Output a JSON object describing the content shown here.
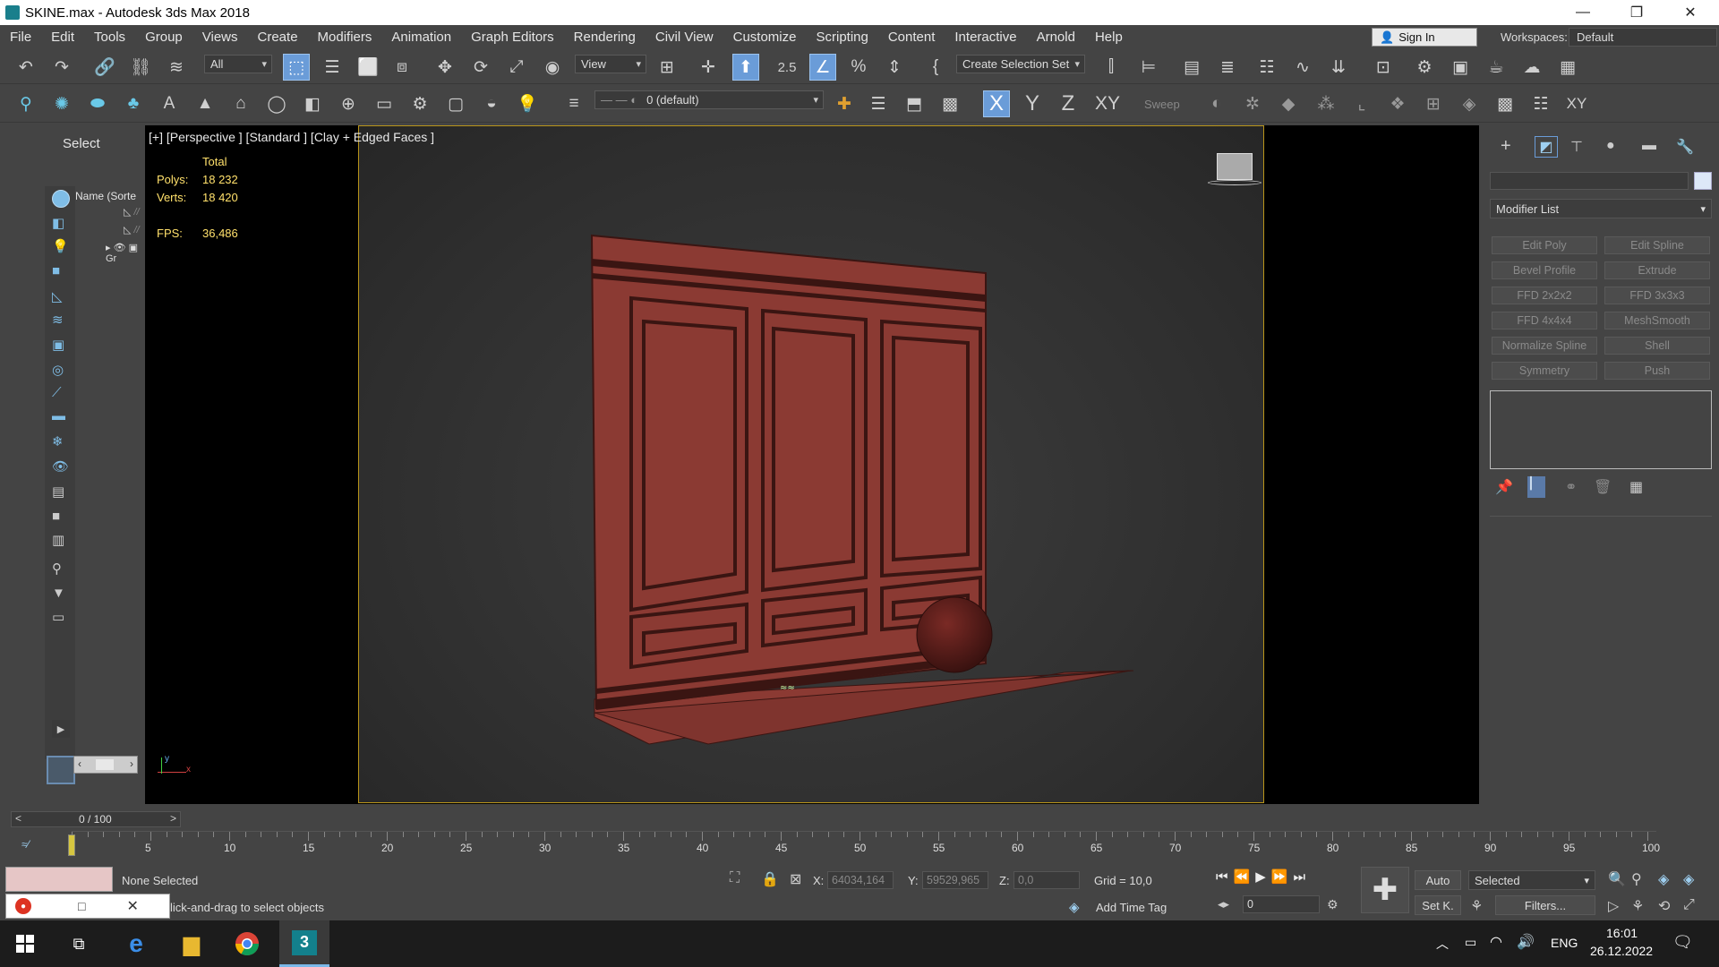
{
  "window": {
    "title": "SKINE.max - Autodesk 3ds Max 2018",
    "minimize": "—",
    "maximize": "❐",
    "close": "✕"
  },
  "menu": {
    "items": [
      "File",
      "Edit",
      "Tools",
      "Group",
      "Views",
      "Create",
      "Modifiers",
      "Animation",
      "Graph Editors",
      "Rendering",
      "Civil View",
      "Customize",
      "Scripting",
      "Content",
      "Interactive",
      "Arnold",
      "Help"
    ],
    "sign_in": "Sign In",
    "workspace_label": "Workspaces:",
    "workspace_value": "Default"
  },
  "toolbar1": {
    "filter_value": "All",
    "ref_coord_value": "View",
    "snap_label": "2.5",
    "selection_set": "Create Selection Set"
  },
  "toolbar2": {
    "layer_value": "0 (default)",
    "axis_x": "X",
    "axis_y": "Y",
    "axis_z": "Z",
    "axis_xy": "XY",
    "sweep_label": "Sweep"
  },
  "explorer": {
    "tab_select": "Select",
    "column_name": "Name (Sorte",
    "rows": [
      "//",
      "//",
      "Gr"
    ]
  },
  "viewport": {
    "label": "[+] [Perspective ] [Standard ] [Clay + Edged Faces ]",
    "stats_header": "Total",
    "polys_label": "Polys:",
    "polys_value": "18 232",
    "verts_label": "Verts:",
    "verts_value": "18 420",
    "fps_label": "FPS:",
    "fps_value": "36,486",
    "axis_y": "y",
    "axis_x": "x"
  },
  "command_panel": {
    "modifier_list": "Modifier List",
    "buttons": [
      "Edit Poly",
      "Edit Spline",
      "Bevel Profile",
      "Extrude",
      "FFD 2x2x2",
      "FFD 3x3x3",
      "FFD 4x4x4",
      "MeshSmooth",
      "Normalize Spline",
      "Shell",
      "Symmetry",
      "Push"
    ]
  },
  "timeline": {
    "frame_counter": "0 / 100",
    "ticks": [
      "5",
      "10",
      "15",
      "20",
      "25",
      "30",
      "35",
      "40",
      "45",
      "50",
      "55",
      "60",
      "65",
      "70",
      "75",
      "80",
      "85",
      "90",
      "95",
      "100"
    ]
  },
  "status": {
    "selection": "None Selected",
    "prompt": "lick-and-drag to select objects",
    "x_label": "X:",
    "x_value": "64034,164",
    "y_label": "Y:",
    "y_value": "59529,965",
    "z_label": "Z:",
    "z_value": "0,0",
    "grid": "Grid = 10,0",
    "add_time_tag": "Add Time Tag",
    "auto_label": "Auto",
    "selected_value": "Selected",
    "setk_label": "Set K.",
    "filters_label": "Filters...",
    "frame_value": "0"
  },
  "taskbar": {
    "lang": "ENG",
    "time": "16:01",
    "date": "26.12.2022"
  },
  "colors": {
    "accent": "#6a9cd8",
    "viewport_border": "#b8941a",
    "model": "#8b3a33"
  }
}
